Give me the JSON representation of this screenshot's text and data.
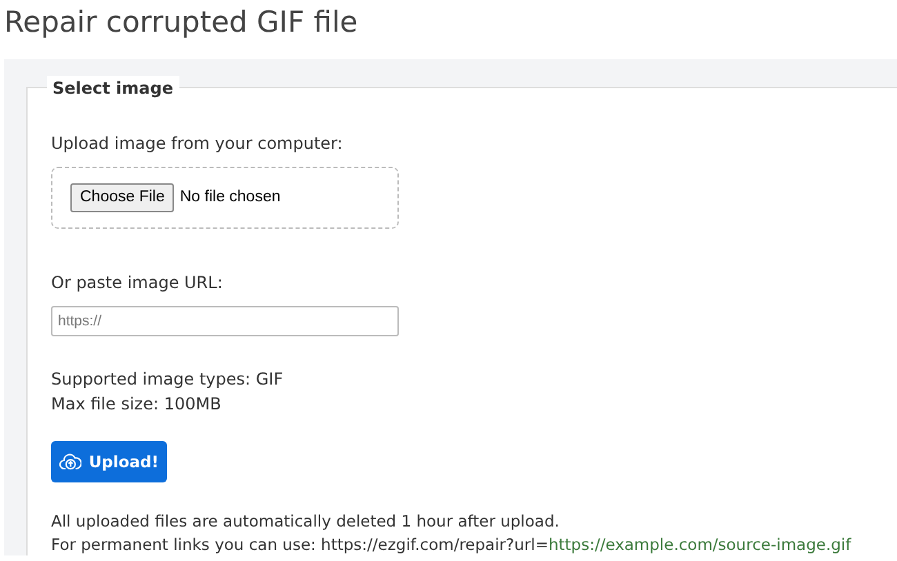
{
  "title": "Repair corrupted GIF file",
  "form": {
    "legend": "Select image",
    "upload_label": "Upload image from your computer:",
    "file_button": "Choose File",
    "file_status": "No file chosen",
    "url_label": "Or paste image URL:",
    "url_field": {
      "placeholder": "https://"
    },
    "info": [
      "Supported image types: GIF",
      "Max file size: 100MB"
    ],
    "submit": "Upload!",
    "notes": [
      {
        "kind": "text",
        "text": "All uploaded files are automatically deleted 1 hour after upload."
      },
      {
        "kind": "link_note",
        "text": "For permanent links you can use: https://ezgif.com/repair?url=",
        "link": "https://example.com/source-image.gif"
      }
    ]
  }
}
